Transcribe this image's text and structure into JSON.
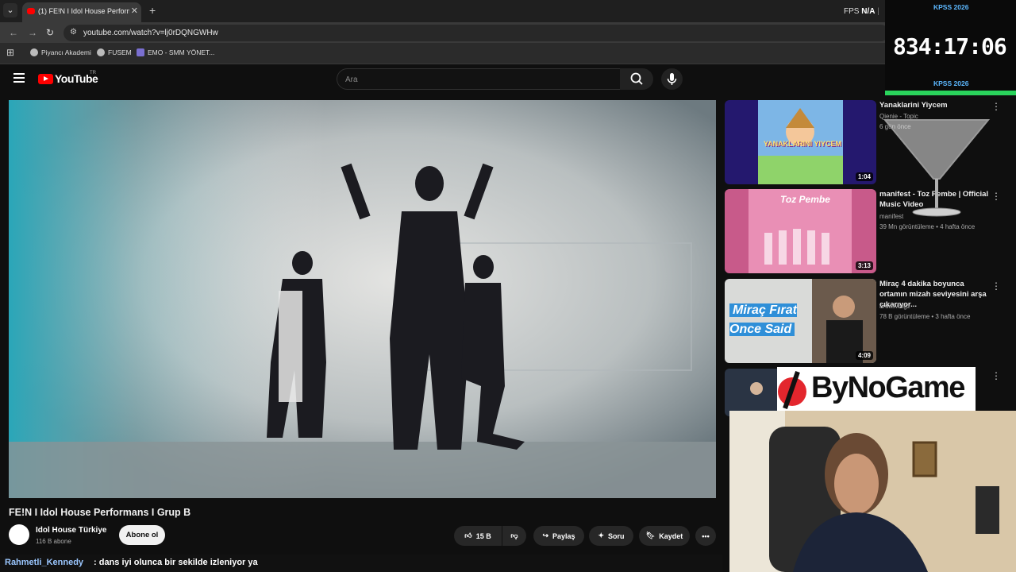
{
  "browser": {
    "tab_title": "(1) FE!N I Idol House Performans I Grup B",
    "new_tab": "+",
    "url": "youtube.com/watch?v=lj0rDQNGWHw",
    "fps_label": "FPS",
    "fps_value": "N/A",
    "bookmarks": [
      "Piyancı Akademi",
      "FUSEM",
      "EMO - SMM YÖNET..."
    ]
  },
  "youtube": {
    "logo": "YouTube",
    "region": "TR",
    "search_placeholder": "Ara"
  },
  "video": {
    "title": "FE!N I Idol House Performans I Grup B",
    "channel": "Idol House Türkiye",
    "subscribers": "116 B abone",
    "subscribe": "Abone ol",
    "likes": "15 B",
    "share": "Paylaş",
    "ask": "Soru",
    "save": "Kaydet"
  },
  "recommendations": [
    {
      "title": "Yanaklarini Yiycem",
      "channel": "Qienie - Topic",
      "meta": "6 gün önce",
      "duration": "1:04",
      "thumb_text": "YANAKLARINI YIYCEM",
      "color": "#7db6e6"
    },
    {
      "title": "manifest - Toz Pembe | Official Music Video",
      "channel": "manifest",
      "meta": "39 Mn görüntüleme • 4 hafta önce",
      "duration": "3:13",
      "thumb_text": "Toz Pembe",
      "color": "#e98fb5"
    },
    {
      "title": "Miraç 4 dakika boyunca ortamın mizah seviyesini arşa çıkarıyor...",
      "channel": "ardaswagz",
      "meta": "78 B görüntüleme • 3 hafta önce",
      "duration": "4:09",
      "thumb_text": "Miraç Fırat Once Said",
      "color": "#2f8fd8"
    },
    {
      "title": "",
      "channel": "",
      "meta": "",
      "duration": "",
      "thumb_text": "",
      "color": "#2a3444"
    }
  ],
  "overlay": {
    "timer_label_top": "KPSS 2026",
    "timer": "834:17:06",
    "timer_label_bottom": "KPSS 2026",
    "sponsor": "ByNoGame"
  },
  "chat": {
    "user": "Rahmetli_Kennedy",
    "message": ": dans iyi olunca bir sekilde izleniyor ya"
  },
  "colors": {
    "accent_red": "#ff0000",
    "timer_blue": "#5cb8ff",
    "timer_green": "#2ad45c"
  }
}
